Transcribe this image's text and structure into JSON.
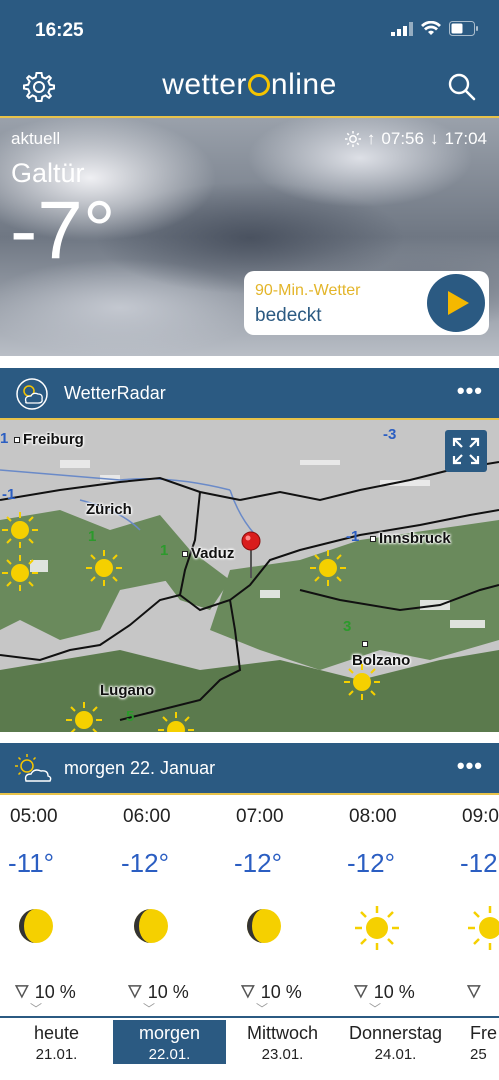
{
  "status_bar": {
    "time": "16:25"
  },
  "header": {
    "logo_text_a": "wetter",
    "logo_text_b": "nline"
  },
  "current": {
    "label": "aktuell",
    "sunrise": "07:56",
    "sunset": "17:04",
    "city": "Galtür",
    "temperature": "-7°",
    "nowcast_title": "90-Min.-Wetter",
    "nowcast_text": "bedeckt"
  },
  "radar": {
    "title": "WetterRadar",
    "more": "•••",
    "cities": [
      "Freiburg",
      "Zürich",
      "Vaduz",
      "Innsbruck",
      "Bolzano",
      "Lugano"
    ],
    "numbers": [
      "1",
      "-3",
      "-1",
      "1",
      "1",
      "-1",
      "3",
      "5"
    ]
  },
  "forecast": {
    "title": "morgen 22. Januar",
    "more": "•••",
    "hours": [
      {
        "time": "05:00",
        "temp": "-11°",
        "icon": "moon-icon",
        "rain": "10 %"
      },
      {
        "time": "06:00",
        "temp": "-12°",
        "icon": "moon-icon",
        "rain": "10 %"
      },
      {
        "time": "07:00",
        "temp": "-12°",
        "icon": "moon-icon",
        "rain": "10 %"
      },
      {
        "time": "08:00",
        "temp": "-12°",
        "icon": "sun-icon",
        "rain": "10 %"
      },
      {
        "time": "09:0",
        "temp": "-12",
        "icon": "sun-icon",
        "rain": ""
      }
    ]
  },
  "days": [
    {
      "name": "heute",
      "date": "21.01."
    },
    {
      "name": "morgen",
      "date": "22.01.",
      "active": true
    },
    {
      "name": "Mittwoch",
      "date": "23.01."
    },
    {
      "name": "Donnerstag",
      "date": "24.01."
    },
    {
      "name": "Fre",
      "date": "25"
    }
  ],
  "colors": {
    "brand_blue": "#2b5a82",
    "accent_gold": "#e8c34a",
    "temp_blue": "#2b5ec2"
  }
}
